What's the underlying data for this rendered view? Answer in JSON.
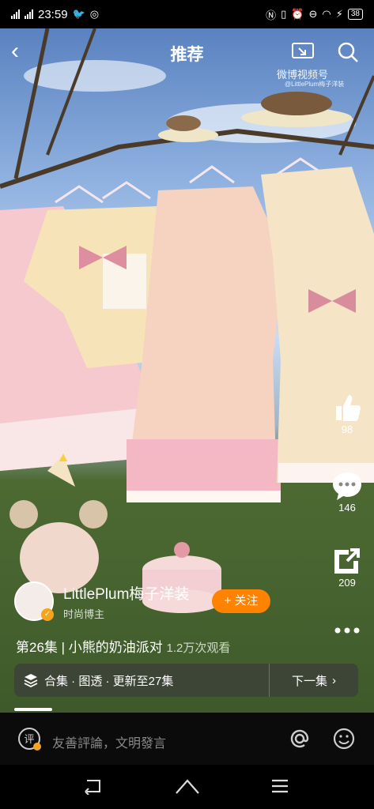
{
  "status_bar": {
    "time": "23:59",
    "battery": "38"
  },
  "header": {
    "title": "推荐"
  },
  "watermark": {
    "brand": "微博视频号",
    "handle": "@LittlePlum梅子洋装"
  },
  "actions": {
    "like_count": "98",
    "comment_count": "146",
    "share_count": "209"
  },
  "author": {
    "name": "LittlePlum梅子洋装",
    "tag": "时尚博主",
    "follow_label": "+ 关注"
  },
  "episode": {
    "title": "第26集 | 小熊的奶油派对",
    "views": "1.2万次观看"
  },
  "collection": {
    "info": "合集 · 图透 · 更新至27集",
    "next_label": "下一集"
  },
  "comment": {
    "placeholder": "友善評論，文明發言"
  },
  "colors": {
    "accent": "#ff8200",
    "badge": "#f7a41d"
  },
  "icons": [
    "back-icon",
    "cast-icon",
    "search-icon",
    "like-icon",
    "comment-icon",
    "share-icon",
    "more-icon",
    "layers-icon",
    "chevron-right-icon",
    "comment-pen-icon",
    "at-icon",
    "emoji-icon",
    "nav-back-icon",
    "nav-home-icon",
    "nav-menu-icon"
  ]
}
